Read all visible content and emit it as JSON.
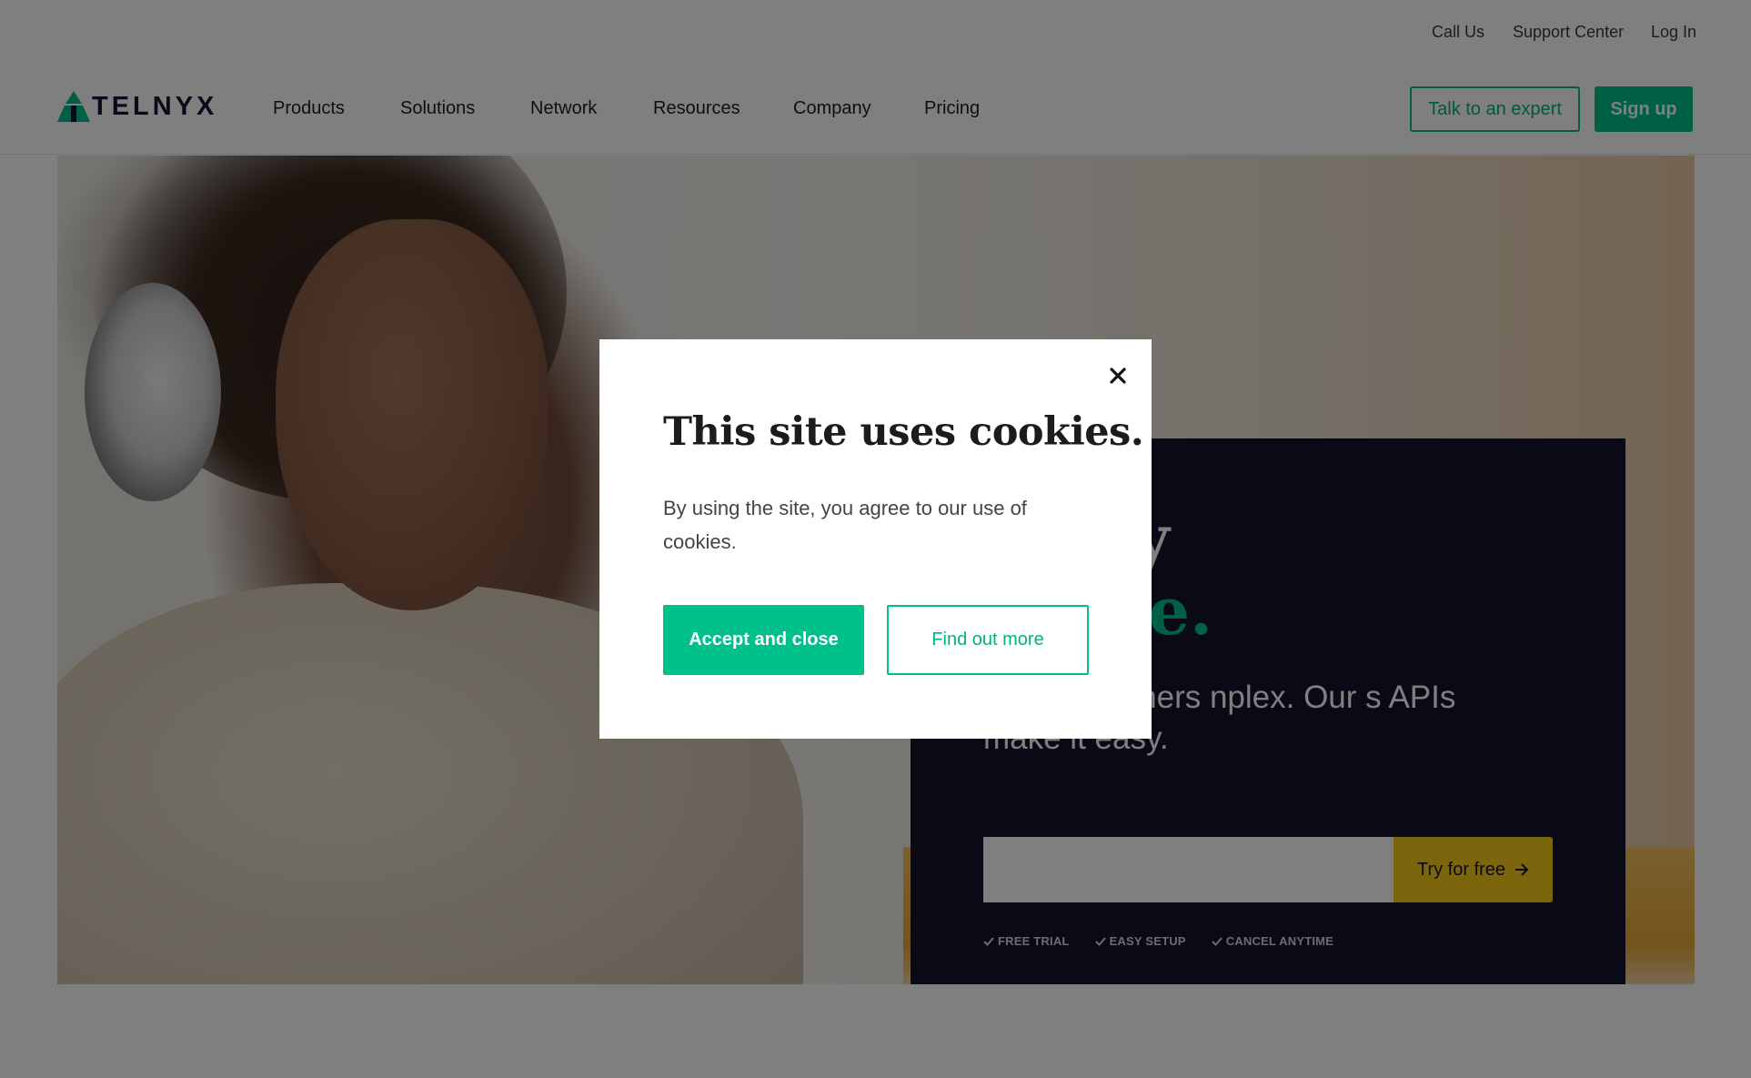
{
  "utility_nav": {
    "call_us": "Call Us",
    "support_center": "Support Center",
    "log_in": "Log In"
  },
  "brand": {
    "name": "TELNYX",
    "logo_icon": "triangle-logo-icon",
    "color_dark": "#0f1530",
    "color_accent": "#00c08b"
  },
  "main_nav": {
    "items": [
      {
        "label": "Products"
      },
      {
        "label": "Solutions"
      },
      {
        "label": "Network"
      },
      {
        "label": "Resources"
      },
      {
        "label": "Company"
      },
      {
        "label": "Pricing"
      }
    ],
    "talk_to_expert": "Talk to an expert",
    "sign_up": "Sign up"
  },
  "hero": {
    "headline_line1": "tivity",
    "headline_line2": "imple.",
    "subtext": "your customers nplex. Our s APIs make it easy.",
    "email_placeholder": "",
    "try_button": "Try for free",
    "try_button_icon": "arrow-right-icon",
    "perks": [
      {
        "label": "FREE TRIAL",
        "icon": "check-icon"
      },
      {
        "label": "EASY SETUP",
        "icon": "check-icon"
      },
      {
        "label": "CANCEL ANYTIME",
        "icon": "check-icon"
      }
    ],
    "card_color": "#12152b",
    "cta_color": "#f7cc1a"
  },
  "cookie_modal": {
    "title": "This site uses cookies.",
    "body": "By using the site, you agree to our use of cookies.",
    "accept_button": "Accept and close",
    "more_button": "Find out more",
    "close_icon": "close-icon"
  }
}
